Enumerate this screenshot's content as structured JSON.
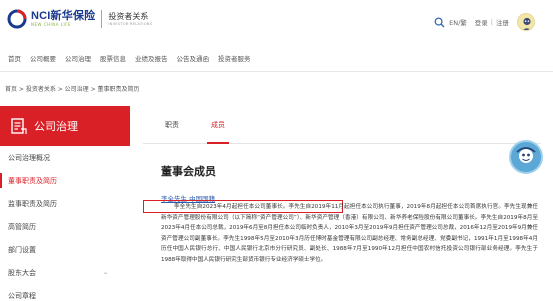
{
  "header": {
    "logo_main": "NCI新华保险",
    "logo_sub": "NEW CHINA LIFE",
    "section_title": "投资者关系",
    "section_sub": "INVESTOR RELATIONS",
    "lang": "EN/繁",
    "login": "登录",
    "register": "注册"
  },
  "nav": {
    "items": [
      "首页",
      "公司概要",
      "公司治理",
      "股票信息",
      "业绩及报告",
      "公告及通函",
      "投资者服务"
    ]
  },
  "breadcrumb": "首页 > 投资者关系 > 公司治理 > 董事职责及简历",
  "sidebar": {
    "title": "公司治理",
    "items": [
      {
        "label": "公司治理概况"
      },
      {
        "label": "董事职责及简历"
      },
      {
        "label": "监事职责及简历"
      },
      {
        "label": "高管简历"
      },
      {
        "label": "部门设置"
      },
      {
        "label": "股东大会"
      },
      {
        "label": "公司章程"
      }
    ],
    "active_index": 1
  },
  "content": {
    "tabs": [
      "职责",
      "成员"
    ],
    "active_tab": 1,
    "section_title": "董事会成员",
    "person_link": "李全先生 中国国籍",
    "bio": "李全先生自2023年4月起担任本公司董事长。李先生自2019年11月起担任本公司执行董事，2019年8月起担任本公司首席执行官。李先生现兼任新华资产管理股份有限公司（以下简称“资产管理公司”）、新华资产管理（香港）有限公司、新华养老保险股份有限公司董事长。李先生自2019年8月至2023年4月任本公司总裁，2019年6月至8月担任本公司临时负责人，2010年3月至2019年9月担任资产管理公司总裁，2016年12月至2019年9月兼任资产管理公司副董事长。李先生1998年5月至2010年3月历任博时基金管理有限公司副总经理、常务副总经理、党委副书记，1991年1月至1998年4月历任中国人民银行总行、中国人民银行北京市分行研究员、副处长、1988年7月至1990年12月担任中国农村信托投资公司银行部业务经理。李先生于1988年取得中国人民银行研究生部货币银行专业经济学硕士学位。"
  },
  "colors": {
    "brand_red": "#d92027",
    "brand_blue": "#1a3a8f",
    "link_blue": "#2a5db0"
  },
  "icons": [
    "search-icon",
    "user-avatar-icon",
    "document-icon",
    "chevron-down-icon",
    "floating-helper-icon"
  ]
}
